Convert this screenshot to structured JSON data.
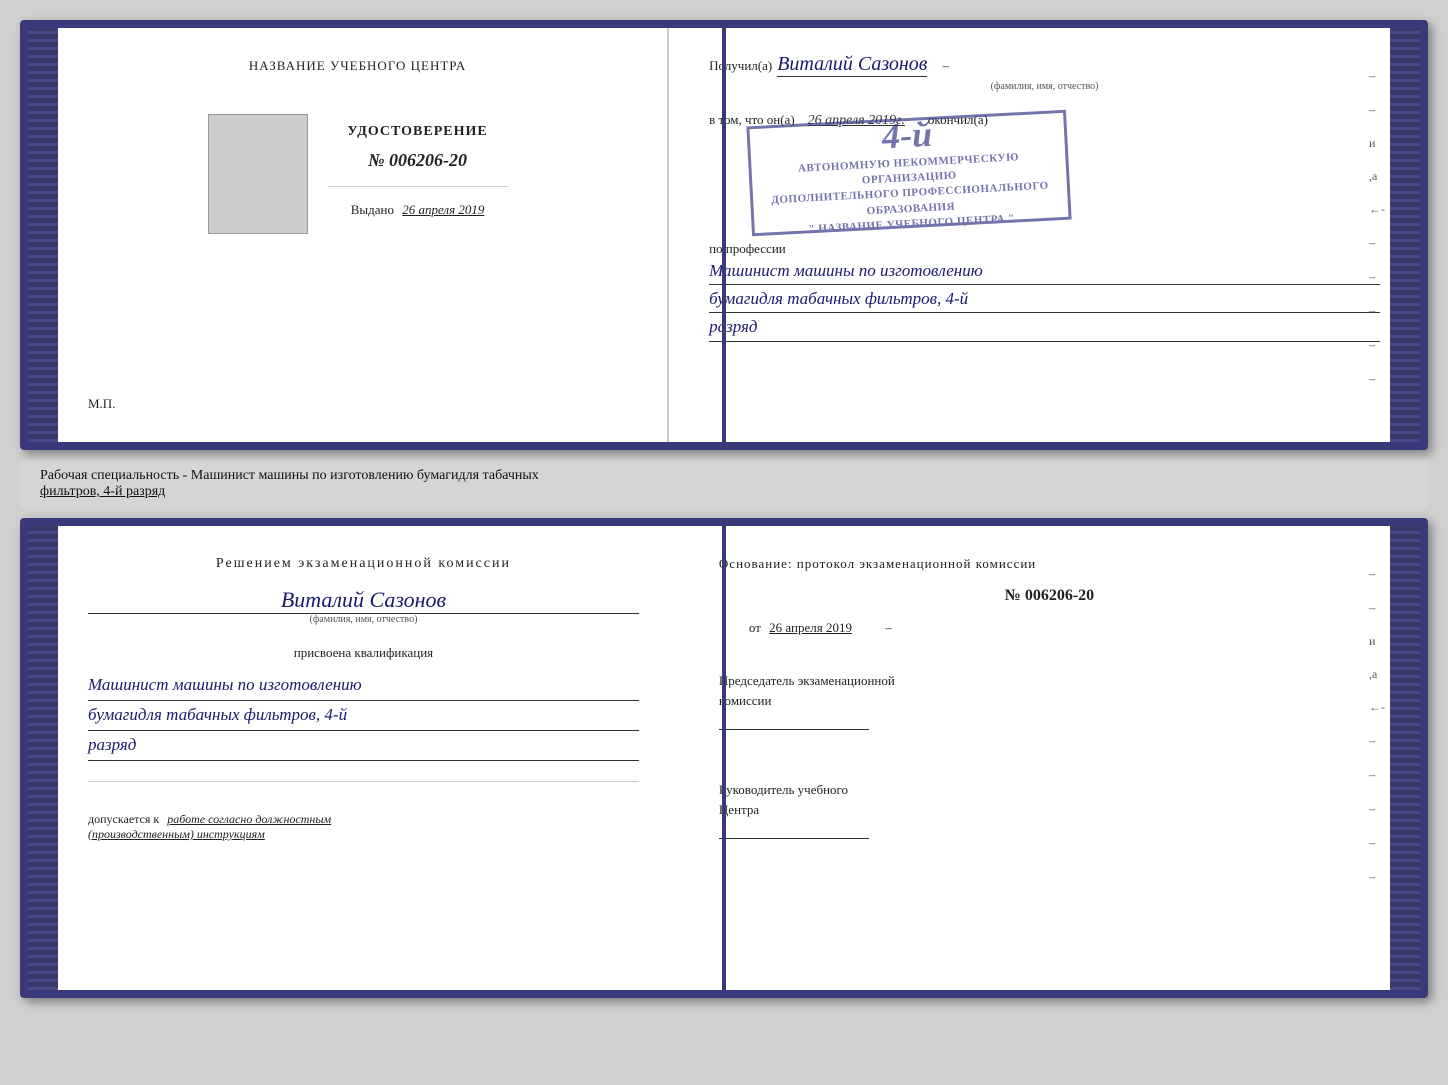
{
  "document": {
    "cert_left": {
      "training_center_label": "НАЗВАНИЕ УЧЕБНОГО ЦЕНТРА",
      "cert_title": "УДОСТОВЕРЕНИЕ",
      "cert_number": "№ 006206-20",
      "issued_label": "Выдано",
      "issued_date": "26 апреля 2019",
      "mp_label": "М.П."
    },
    "cert_right": {
      "received_prefix": "Получил(а)",
      "recipient_name": "Виталий Сазонов",
      "recipient_sublabel": "(фамилия, имя, отчество)",
      "dash": "–",
      "date_prefix": "в том, что он(а)",
      "date_value": "26 апреля 2019г.",
      "completed_label": "окончил(а)",
      "stamp_line1": "4-й",
      "stamp_line2": "АВТОНОМНУЮ НЕКОММЕРЧЕСКУЮ ОРГАНИЗАЦИЮ",
      "stamp_line3": "ДОПОЛНИТЕЛЬНОГО ПРОФЕССИОНАЛЬНОГО ОБРАЗОВАНИЯ",
      "stamp_line4": "\" НАЗВАНИЕ УЧЕБНОГО ЦЕНТРА \"",
      "profession_prefix": "по профессии",
      "profession_text1": "Машинист машины по изготовлению",
      "profession_text2": "бумагидля табачных фильтров, 4-й",
      "profession_text3": "разряд"
    },
    "separator": {
      "text1": "Рабочая специальность - Машинист машины по изготовлению бумагидля табачных",
      "text2": "фильтров, 4-й разряд"
    },
    "bottom_left": {
      "decision_title": "Решением  экзаменационной  комиссии",
      "person_name": "Виталий Сазонов",
      "fio_sublabel": "(фамилия, имя, отчество)",
      "qualification_prefix": "присвоена квалификация",
      "qualification_line1": "Машинист машины по изготовлению",
      "qualification_line2": "бумагидля табачных фильтров, 4-й",
      "qualification_line3": "разряд",
      "allowed_prefix": "допускается к",
      "allowed_text": "работе согласно должностным",
      "allowed_text2": "(производственным) инструкциям"
    },
    "bottom_right": {
      "basis_label": "Основание: протокол экзаменационной  комиссии",
      "protocol_number": "№  006206-20",
      "date_prefix": "от",
      "date_value": "26 апреля 2019",
      "chairman_label": "Председатель экзаменационной",
      "chairman_label2": "комиссии",
      "director_label": "Руководитель учебного",
      "director_label2": "Центра",
      "side_chars": [
        "и",
        "а",
        "←",
        "–",
        "–",
        "–",
        "–"
      ]
    }
  }
}
